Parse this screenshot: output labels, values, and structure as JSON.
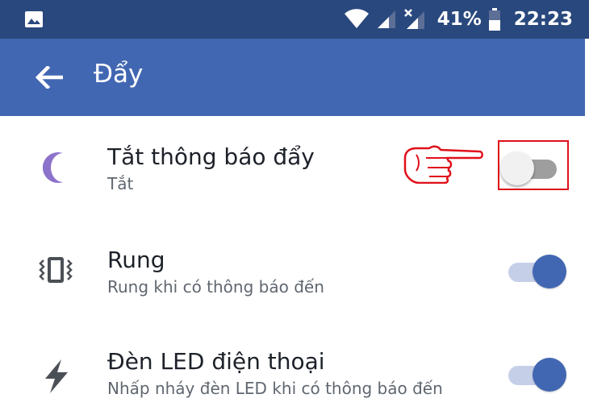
{
  "status_bar": {
    "battery_percent": "41%",
    "time": "22:23",
    "icons": [
      "image-icon",
      "wifi-icon",
      "signal-icon",
      "no-signal-icon",
      "battery-icon"
    ]
  },
  "app_bar": {
    "title": "Đẩy",
    "back_icon": "arrow-left-icon",
    "color": "#4267b2"
  },
  "settings": [
    {
      "icon": "moon-icon",
      "title": "Tắt thông báo đẩy",
      "subtitle": "Tắt",
      "enabled": false
    },
    {
      "icon": "vibrate-icon",
      "title": "Rung",
      "subtitle": "Rung khi có thông báo đến",
      "enabled": true
    },
    {
      "icon": "bolt-icon",
      "title": "Đèn LED điện thoại",
      "subtitle": "Nhấp nháy đèn LED khi có thông báo đến",
      "enabled": true
    }
  ],
  "annotation": {
    "pointer": "pointing-hand-icon",
    "highlight_color": "#e0101a"
  }
}
